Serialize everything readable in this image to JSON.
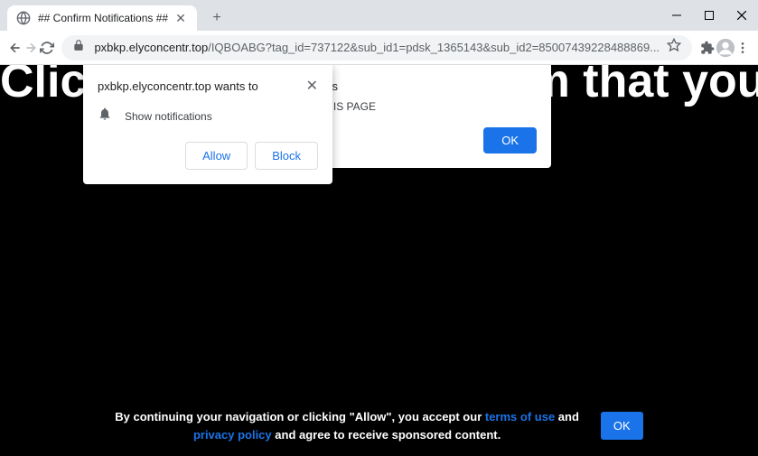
{
  "tab": {
    "title": "## Confirm Notifications ##"
  },
  "url": {
    "domain": "pxbkp.elyconcentr.top",
    "path": "/IQBOABG?tag_id=737122&sub_id1=pdsk_1365143&sub_id2=85007439228488869..."
  },
  "page": {
    "headline": "Click « Allow » to confirm that you are"
  },
  "perm_dialog": {
    "title": "pxbkp.elyconcentr.top wants to",
    "text": "Show notifications",
    "allow": "Allow",
    "block": "Block"
  },
  "alert_dialog": {
    "title_suffix": "p says",
    "body_suffix": "THIS PAGE",
    "ok": "OK"
  },
  "cookie": {
    "text1": "By continuing your navigation or clicking \"Allow\", you accept our ",
    "link1": "terms of use",
    "text2": " and ",
    "link2": "privacy policy",
    "text3": " and agree to receive sponsored content.",
    "ok": "OK"
  }
}
